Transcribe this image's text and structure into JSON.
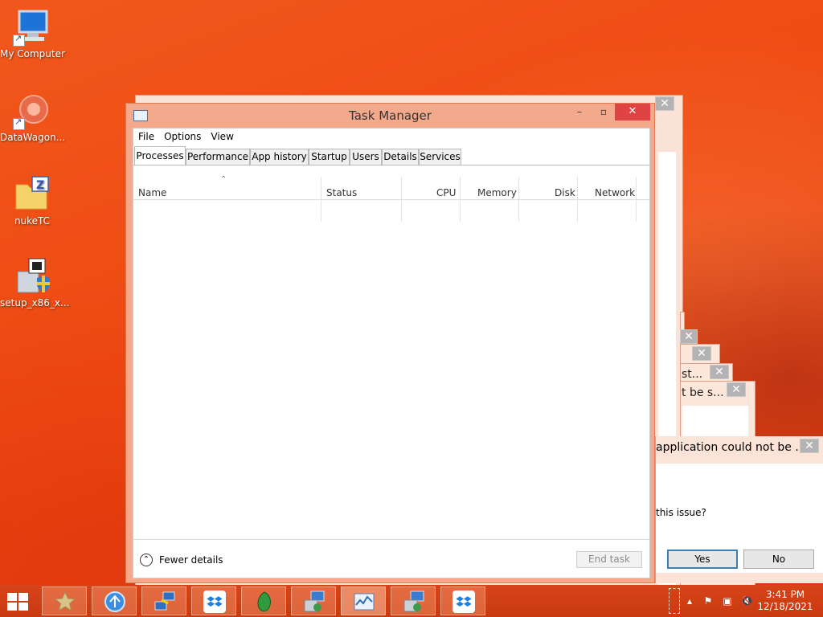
{
  "desktop": {
    "icons": [
      {
        "label": "My Computer",
        "icon": "computer-icon"
      },
      {
        "label": "DataWagon...",
        "icon": "datawagon-icon"
      },
      {
        "label": "nukeTC",
        "icon": "folder-icon"
      },
      {
        "label": "setup_x86_x...",
        "icon": "installer-icon"
      }
    ]
  },
  "background_dialogs": {
    "stack_texts": [
      "st...",
      "t be s..."
    ],
    "app_dialog": {
      "message": "application could not be ...",
      "question": "this issue?",
      "yes_label": "Yes",
      "no_label": "No"
    }
  },
  "task_manager": {
    "title": "Task Manager",
    "menu": [
      "File",
      "Options",
      "View"
    ],
    "tabs": [
      "Processes",
      "Performance",
      "App history",
      "Startup",
      "Users",
      "Details",
      "Services"
    ],
    "active_tab": "Processes",
    "columns": [
      "Name",
      "Status",
      "CPU",
      "Memory",
      "Disk",
      "Network"
    ],
    "fewer_details": "Fewer details",
    "end_task": "End task"
  },
  "taskbar": {
    "clock": {
      "time": "3:41 PM",
      "date": "12/18/2021"
    },
    "apps": [
      "favorites-icon",
      "network-globe-icon",
      "remote-desktop-icon",
      "dropbox-icon",
      "green-gem-icon",
      "installer-icon",
      "task-manager-icon",
      "installer-icon",
      "dropbox-icon"
    ]
  },
  "colors": {
    "desktop_accent": "#ee4a12",
    "window_frame": "#f3a98c",
    "close_button": "#e04343"
  }
}
